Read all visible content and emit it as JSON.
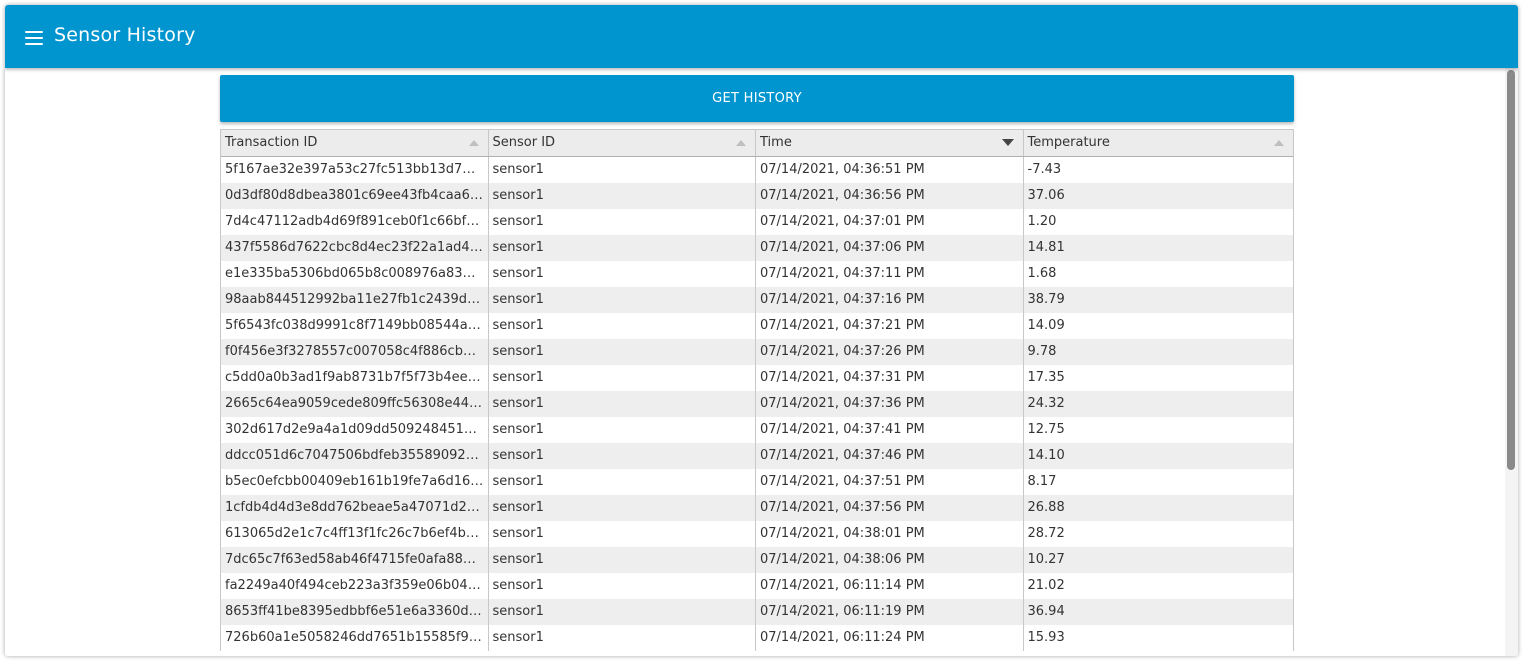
{
  "app": {
    "title": "Sensor History",
    "menu_icon": "hamburger-menu-icon",
    "accent_color": "#0095cf"
  },
  "actions": {
    "get_history_label": "GET HISTORY"
  },
  "table": {
    "columns": [
      {
        "label": "Transaction ID",
        "sort": "none"
      },
      {
        "label": "Sensor ID",
        "sort": "none"
      },
      {
        "label": "Time",
        "sort": "descending"
      },
      {
        "label": "Temperature",
        "sort": "none"
      }
    ],
    "rows": [
      [
        "5f167ae32e397a53c27fc513bb13d777e…",
        "sensor1",
        "07/14/2021, 04:36:51 PM",
        "-7.43"
      ],
      [
        "0d3df80d8dbea3801c69ee43fb4caa65…",
        "sensor1",
        "07/14/2021, 04:36:56 PM",
        "37.06"
      ],
      [
        "7d4c47112adb4d69f891ceb0f1c66bf2b…",
        "sensor1",
        "07/14/2021, 04:37:01 PM",
        "1.20"
      ],
      [
        "437f5586d7622cbc8d4ec23f22a1ad4fc…",
        "sensor1",
        "07/14/2021, 04:37:06 PM",
        "14.81"
      ],
      [
        "e1e335ba5306bd065b8c008976a836c…",
        "sensor1",
        "07/14/2021, 04:37:11 PM",
        "1.68"
      ],
      [
        "98aab844512992ba11e27fb1c2439dc0…",
        "sensor1",
        "07/14/2021, 04:37:16 PM",
        "38.79"
      ],
      [
        "5f6543fc038d9991c8f7149bb08544a1…",
        "sensor1",
        "07/14/2021, 04:37:21 PM",
        "14.09"
      ],
      [
        "f0f456e3f3278557c007058c4f886cbab…",
        "sensor1",
        "07/14/2021, 04:37:26 PM",
        "9.78"
      ],
      [
        "c5dd0a0b3ad1f9ab8731b7f5f73b4ee49…",
        "sensor1",
        "07/14/2021, 04:37:31 PM",
        "17.35"
      ],
      [
        "2665c64ea9059cede809ffc56308e443…",
        "sensor1",
        "07/14/2021, 04:37:36 PM",
        "24.32"
      ],
      [
        "302d617d2e9a4a1d09dd50924845159…",
        "sensor1",
        "07/14/2021, 04:37:41 PM",
        "12.75"
      ],
      [
        "ddcc051d6c7047506bdfeb35589092cb…",
        "sensor1",
        "07/14/2021, 04:37:46 PM",
        "14.10"
      ],
      [
        "b5ec0efcbb00409eb161b19fe7a6d16b…",
        "sensor1",
        "07/14/2021, 04:37:51 PM",
        "8.17"
      ],
      [
        "1cfdb4d4d3e8dd762beae5a47071d236…",
        "sensor1",
        "07/14/2021, 04:37:56 PM",
        "26.88"
      ],
      [
        "613065d2e1c7c4ff13f1fc26c7b6ef4bdf0…",
        "sensor1",
        "07/14/2021, 04:38:01 PM",
        "28.72"
      ],
      [
        "7dc65c7f63ed58ab46f4715fe0afa884c…",
        "sensor1",
        "07/14/2021, 04:38:06 PM",
        "10.27"
      ],
      [
        "fa2249a40f494ceb223a3f359e06b043…",
        "sensor1",
        "07/14/2021, 06:11:14 PM",
        "21.02"
      ],
      [
        "8653ff41be8395edbbf6e51e6a3360dd…",
        "sensor1",
        "07/14/2021, 06:11:19 PM",
        "36.94"
      ],
      [
        "726b60a1e5058246dd7651b15585f96a…",
        "sensor1",
        "07/14/2021, 06:11:24 PM",
        "15.93"
      ]
    ]
  }
}
